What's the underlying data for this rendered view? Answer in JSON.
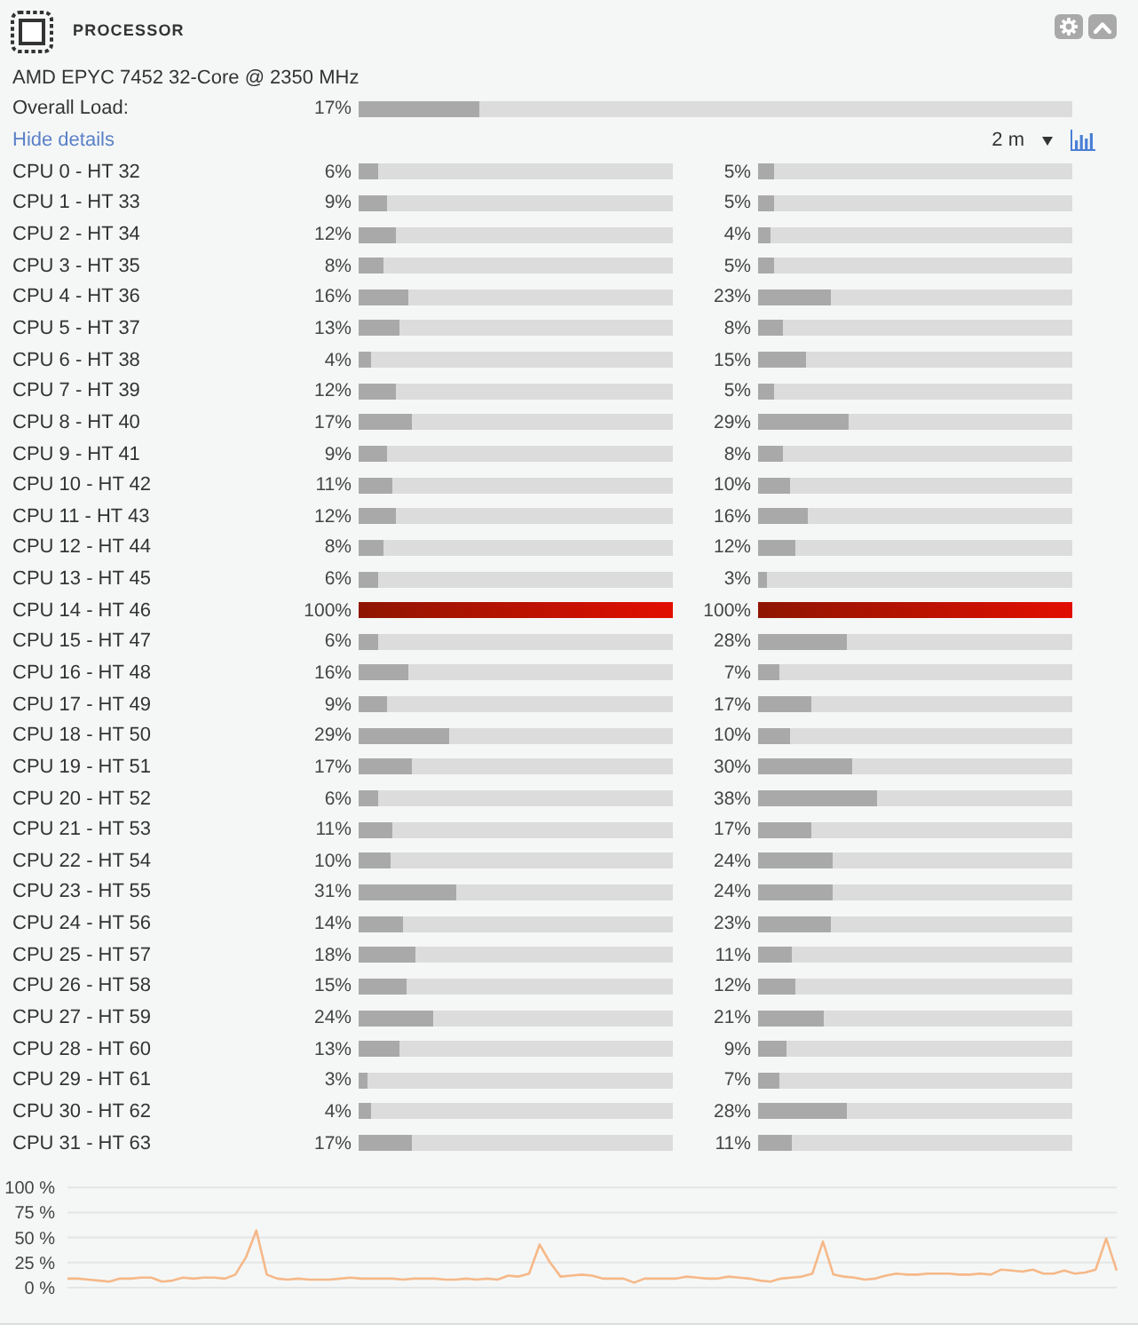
{
  "header": {
    "title": "PROCESSOR"
  },
  "processor_name": "AMD EPYC 7452 32-Core @ 2350 MHz",
  "overall_load": {
    "label": "Overall Load:",
    "reading": "17%",
    "level": 0.17
  },
  "details_toggle": {
    "label": "Hide details"
  },
  "time_range": {
    "value": "2 m"
  },
  "cores": [
    {
      "name": "CPU 0 - HT 32",
      "threads": [
        {
          "reading": "6%",
          "level": 0.06
        },
        {
          "reading": "5%",
          "level": 0.05
        }
      ]
    },
    {
      "name": "CPU 1 - HT 33",
      "threads": [
        {
          "reading": "9%",
          "level": 0.09
        },
        {
          "reading": "5%",
          "level": 0.05
        }
      ]
    },
    {
      "name": "CPU 2 - HT 34",
      "threads": [
        {
          "reading": "12%",
          "level": 0.12
        },
        {
          "reading": "4%",
          "level": 0.04
        }
      ]
    },
    {
      "name": "CPU 3 - HT 35",
      "threads": [
        {
          "reading": "8%",
          "level": 0.08
        },
        {
          "reading": "5%",
          "level": 0.05
        }
      ]
    },
    {
      "name": "CPU 4 - HT 36",
      "threads": [
        {
          "reading": "16%",
          "level": 0.16
        },
        {
          "reading": "23%",
          "level": 0.23
        }
      ]
    },
    {
      "name": "CPU 5 - HT 37",
      "threads": [
        {
          "reading": "13%",
          "level": 0.13
        },
        {
          "reading": "8%",
          "level": 0.08
        }
      ]
    },
    {
      "name": "CPU 6 - HT 38",
      "threads": [
        {
          "reading": "4%",
          "level": 0.04
        },
        {
          "reading": "15%",
          "level": 0.15
        }
      ]
    },
    {
      "name": "CPU 7 - HT 39",
      "threads": [
        {
          "reading": "12%",
          "level": 0.12
        },
        {
          "reading": "5%",
          "level": 0.05
        }
      ]
    },
    {
      "name": "CPU 8 - HT 40",
      "threads": [
        {
          "reading": "17%",
          "level": 0.17
        },
        {
          "reading": "29%",
          "level": 0.29
        }
      ]
    },
    {
      "name": "CPU 9 - HT 41",
      "threads": [
        {
          "reading": "9%",
          "level": 0.09
        },
        {
          "reading": "8%",
          "level": 0.08
        }
      ]
    },
    {
      "name": "CPU 10 - HT 42",
      "threads": [
        {
          "reading": "11%",
          "level": 0.11
        },
        {
          "reading": "10%",
          "level": 0.1
        }
      ]
    },
    {
      "name": "CPU 11 - HT 43",
      "threads": [
        {
          "reading": "12%",
          "level": 0.12
        },
        {
          "reading": "16%",
          "level": 0.16
        }
      ]
    },
    {
      "name": "CPU 12 - HT 44",
      "threads": [
        {
          "reading": "8%",
          "level": 0.08
        },
        {
          "reading": "12%",
          "level": 0.12
        }
      ]
    },
    {
      "name": "CPU 13 - HT 45",
      "threads": [
        {
          "reading": "6%",
          "level": 0.06
        },
        {
          "reading": "3%",
          "level": 0.03
        }
      ]
    },
    {
      "name": "CPU 14 - HT 46",
      "threads": [
        {
          "reading": "100%",
          "level": 1
        },
        {
          "reading": "100%",
          "level": 1
        }
      ]
    },
    {
      "name": "CPU 15 - HT 47",
      "threads": [
        {
          "reading": "6%",
          "level": 0.06
        },
        {
          "reading": "28%",
          "level": 0.28
        }
      ]
    },
    {
      "name": "CPU 16 - HT 48",
      "threads": [
        {
          "reading": "16%",
          "level": 0.16
        },
        {
          "reading": "7%",
          "level": 0.07
        }
      ]
    },
    {
      "name": "CPU 17 - HT 49",
      "threads": [
        {
          "reading": "9%",
          "level": 0.09
        },
        {
          "reading": "17%",
          "level": 0.17
        }
      ]
    },
    {
      "name": "CPU 18 - HT 50",
      "threads": [
        {
          "reading": "29%",
          "level": 0.29
        },
        {
          "reading": "10%",
          "level": 0.1
        }
      ]
    },
    {
      "name": "CPU 19 - HT 51",
      "threads": [
        {
          "reading": "17%",
          "level": 0.17
        },
        {
          "reading": "30%",
          "level": 0.3
        }
      ]
    },
    {
      "name": "CPU 20 - HT 52",
      "threads": [
        {
          "reading": "6%",
          "level": 0.06
        },
        {
          "reading": "38%",
          "level": 0.38
        }
      ]
    },
    {
      "name": "CPU 21 - HT 53",
      "threads": [
        {
          "reading": "11%",
          "level": 0.11
        },
        {
          "reading": "17%",
          "level": 0.17
        }
      ]
    },
    {
      "name": "CPU 22 - HT 54",
      "threads": [
        {
          "reading": "10%",
          "level": 0.1
        },
        {
          "reading": "24%",
          "level": 0.24
        }
      ]
    },
    {
      "name": "CPU 23 - HT 55",
      "threads": [
        {
          "reading": "31%",
          "level": 0.31
        },
        {
          "reading": "24%",
          "level": 0.24
        }
      ]
    },
    {
      "name": "CPU 24 - HT 56",
      "threads": [
        {
          "reading": "14%",
          "level": 0.14
        },
        {
          "reading": "23%",
          "level": 0.23
        }
      ]
    },
    {
      "name": "CPU 25 - HT 57",
      "threads": [
        {
          "reading": "18%",
          "level": 0.18
        },
        {
          "reading": "11%",
          "level": 0.11
        }
      ]
    },
    {
      "name": "CPU 26 - HT 58",
      "threads": [
        {
          "reading": "15%",
          "level": 0.15
        },
        {
          "reading": "12%",
          "level": 0.12
        }
      ]
    },
    {
      "name": "CPU 27 - HT 59",
      "threads": [
        {
          "reading": "24%",
          "level": 0.24
        },
        {
          "reading": "21%",
          "level": 0.21
        }
      ]
    },
    {
      "name": "CPU 28 - HT 60",
      "threads": [
        {
          "reading": "13%",
          "level": 0.13
        },
        {
          "reading": "9%",
          "level": 0.09
        }
      ]
    },
    {
      "name": "CPU 29 - HT 61",
      "threads": [
        {
          "reading": "3%",
          "level": 0.03
        },
        {
          "reading": "7%",
          "level": 0.07
        }
      ]
    },
    {
      "name": "CPU 30 - HT 62",
      "threads": [
        {
          "reading": "4%",
          "level": 0.04
        },
        {
          "reading": "28%",
          "level": 0.28
        }
      ]
    },
    {
      "name": "CPU 31 - HT 63",
      "threads": [
        {
          "reading": "17%",
          "level": 0.17
        },
        {
          "reading": "11%",
          "level": 0.11
        }
      ]
    }
  ],
  "load_chart": {
    "chart_data": {
      "type": "line",
      "grid": true,
      "ylim": [
        0,
        100
      ],
      "yticks": [
        {
          "value": 0,
          "label": "0 %"
        },
        {
          "value": 25,
          "label": "25 %"
        },
        {
          "value": 50,
          "label": "50 %"
        },
        {
          "value": 75,
          "label": "75 %"
        },
        {
          "value": 100,
          "label": "100 %"
        }
      ],
      "values": [
        9,
        9,
        8,
        7,
        6,
        9,
        9,
        10,
        10,
        6,
        7,
        10,
        9,
        10,
        10,
        9,
        13,
        30,
        57,
        13,
        9,
        8,
        9,
        8,
        8,
        8,
        9,
        10,
        9,
        9,
        9,
        9,
        8,
        9,
        9,
        9,
        8,
        8,
        9,
        8,
        9,
        8,
        12,
        11,
        14,
        43,
        25,
        11,
        12,
        13,
        12,
        9,
        9,
        9,
        5,
        9,
        9,
        9,
        9,
        11,
        10,
        9,
        9,
        11,
        10,
        9,
        7,
        6,
        9,
        10,
        11,
        14,
        46,
        13,
        11,
        10,
        8,
        9,
        12,
        14,
        13,
        13,
        14,
        14,
        14,
        13,
        13,
        14,
        13,
        18,
        17,
        16,
        18,
        14,
        14,
        17,
        14,
        15,
        18,
        49,
        17
      ]
    }
  }
}
